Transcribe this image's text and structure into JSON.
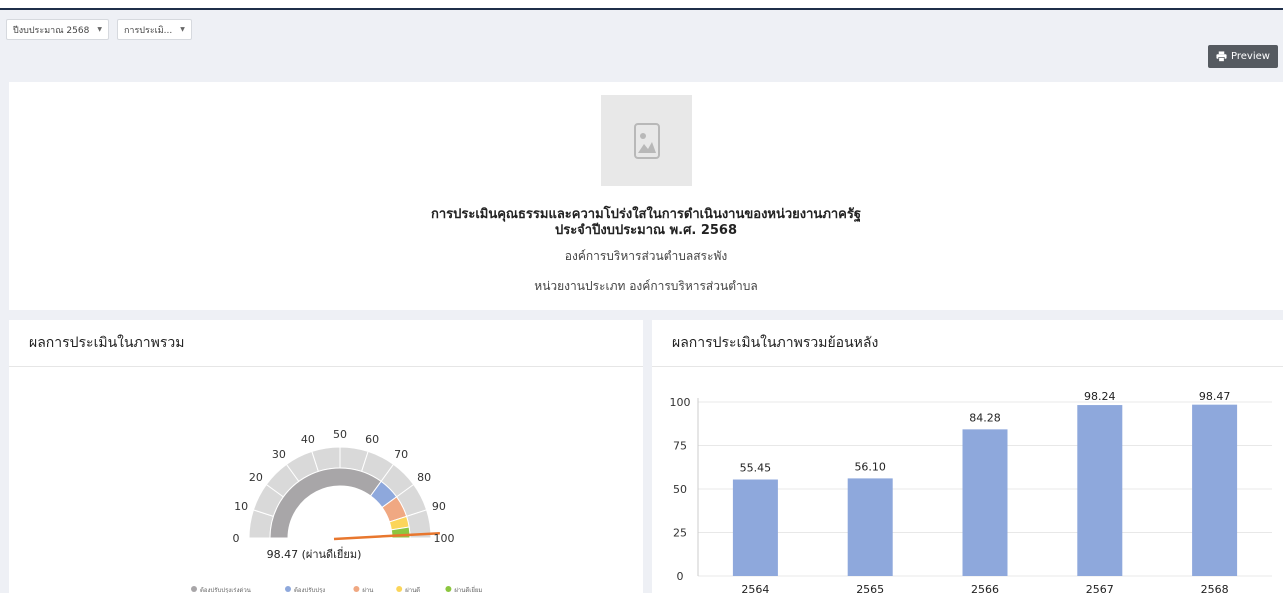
{
  "filters": [
    {
      "label": "ปีงบประมาณ 2568"
    },
    {
      "label": "การประเมิ..."
    }
  ],
  "toolbar": {
    "preview_label": "Preview"
  },
  "header": {
    "title_line1": "การประเมินคุณธรรมและความโปร่งใสในการดำเนินงานของหน่วยงานภาครัฐ",
    "title_line2": "ประจำปีงบประมาณ พ.ศ. 2568",
    "org_name": "องค์การบริหารส่วนตำบลสระพัง",
    "org_type": "หน่วยงานประเภท องค์การบริหารส่วนตำบล"
  },
  "gauge_card": {
    "title": "ผลการประเมินในภาพรวม",
    "score_label": "98.47 (ผ่านดีเยี่ยม)",
    "score": 98.47,
    "ticks": [
      "0",
      "10",
      "20",
      "30",
      "40",
      "50",
      "60",
      "70",
      "80",
      "90",
      "100"
    ],
    "legend": [
      {
        "label": "ต้องปรับปรุงเร่งด่วน",
        "color": "#a8a6a8"
      },
      {
        "label": "ต้องปรับปรุง",
        "color": "#8ea8dc"
      },
      {
        "label": "ผ่าน",
        "color": "#f0a882"
      },
      {
        "label": "ผ่านดี",
        "color": "#fbd55a"
      },
      {
        "label": "ผ่านดีเยี่ยม",
        "color": "#8cc63f"
      }
    ]
  },
  "bar_card": {
    "title": "ผลการประเมินในภาพรวมย้อนหลัง"
  },
  "chart_data": {
    "type": "bar",
    "categories": [
      "2564",
      "2565",
      "2566",
      "2567",
      "2568"
    ],
    "values": [
      55.45,
      56.1,
      84.28,
      98.24,
      98.47
    ],
    "data_labels": [
      "55.45",
      "56.10",
      "84.28",
      "98.24",
      "98.47"
    ],
    "y_ticks": [
      "0",
      "25",
      "50",
      "75",
      "100"
    ],
    "ylim": [
      0,
      100
    ],
    "grid": true,
    "bar_color": "#8ea8dc"
  }
}
